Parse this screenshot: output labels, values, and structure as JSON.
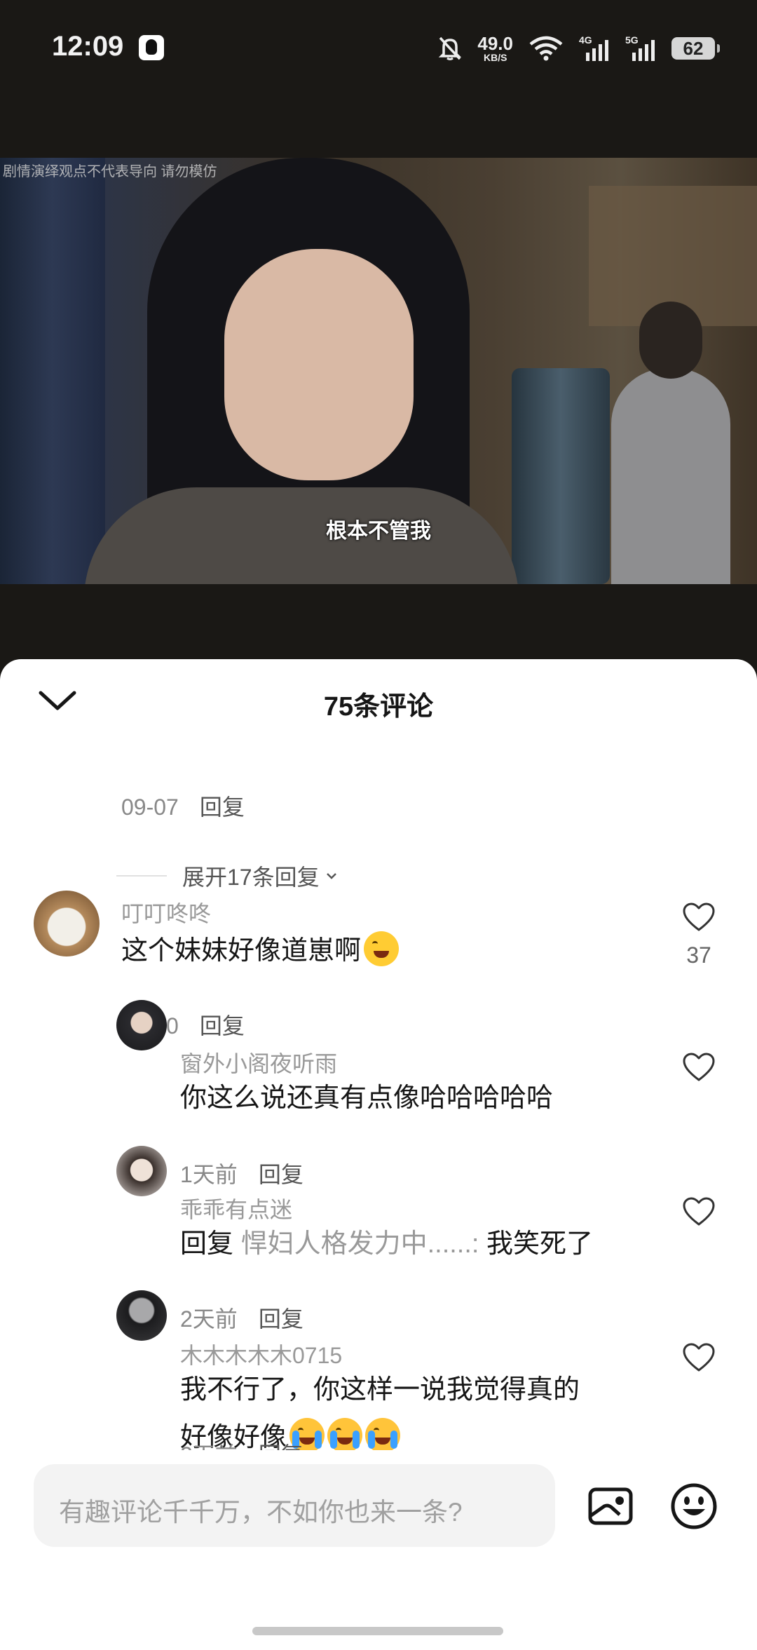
{
  "status_bar": {
    "time": "12:09",
    "net_speed": "49.0",
    "net_unit": "KB/S",
    "sig1": "4G",
    "sig2": "5G",
    "battery": "62"
  },
  "video": {
    "watermark": "剧情演绎观点不代表导向 请勿模仿",
    "subtitle": "根本不管我"
  },
  "comments_sheet": {
    "title": "75条评论",
    "prev_comment": {
      "date": "09-07",
      "reply_label": "回复"
    },
    "expand_replies": "展开17条回复",
    "comment": {
      "username": "叮叮咚咚",
      "text": "这个妹妹好像道崽啊",
      "date": "09-10",
      "reply_label": "回复",
      "likes": "37"
    },
    "replies": [
      {
        "username": "窗外小阁夜听雨",
        "text": "你这么说还真有点像哈哈哈哈哈",
        "date": "1天前",
        "reply_label": "回复"
      },
      {
        "username": "乖乖有点迷",
        "reply_prefix": "回复",
        "reply_target": "悍妇人格发力中......:",
        "text": "我笑死了",
        "date": "2天前",
        "reply_label": "回复"
      },
      {
        "username": "木木木木木0715",
        "text_line1": "我不行了，你这样一说我觉得真的",
        "text_line2": "好像好像",
        "date": "2天前",
        "reply_label": "回复"
      }
    ]
  },
  "input_bar": {
    "placeholder": "有趣评论千千万，不如你也来一条?"
  }
}
